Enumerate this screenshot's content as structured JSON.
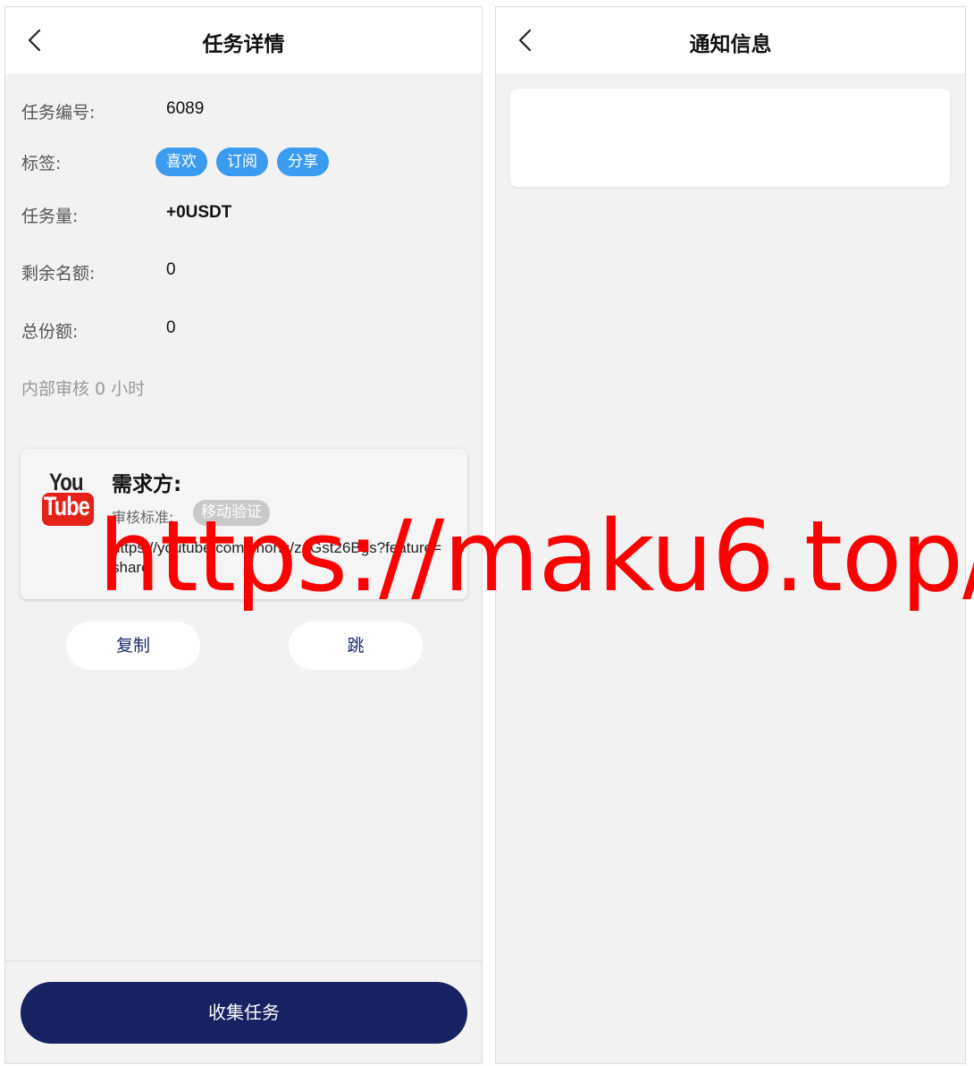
{
  "left": {
    "title": "任务详情",
    "rows": [
      {
        "label": "任务编号:",
        "value": "6089"
      },
      {
        "label": "标签:"
      },
      {
        "label": "任务量:",
        "value": "+0USDT"
      },
      {
        "label": "剩余名额:",
        "value": "0"
      },
      {
        "label": "总份额:",
        "value": "0"
      }
    ],
    "tags": [
      "喜欢",
      "订阅",
      "分享"
    ],
    "note": "内部审核 0 小时",
    "requester": {
      "logo_top": "You",
      "logo_bottom": "Tube",
      "title": "需求方:",
      "std_label": "审核标准:",
      "std_badge": "移动验证",
      "link": "https://youtube.com/shorts/zaGst26Bgs?feature=share"
    },
    "buttons": {
      "copy": "复制",
      "jump": "跳"
    },
    "collect": "收集任务"
  },
  "right": {
    "title": "通知信息"
  },
  "watermark": "https://maku6.top/",
  "colors": {
    "tag_bg": "#3b9bf0",
    "primary_button": "#172262",
    "watermark": "#ff0000"
  }
}
